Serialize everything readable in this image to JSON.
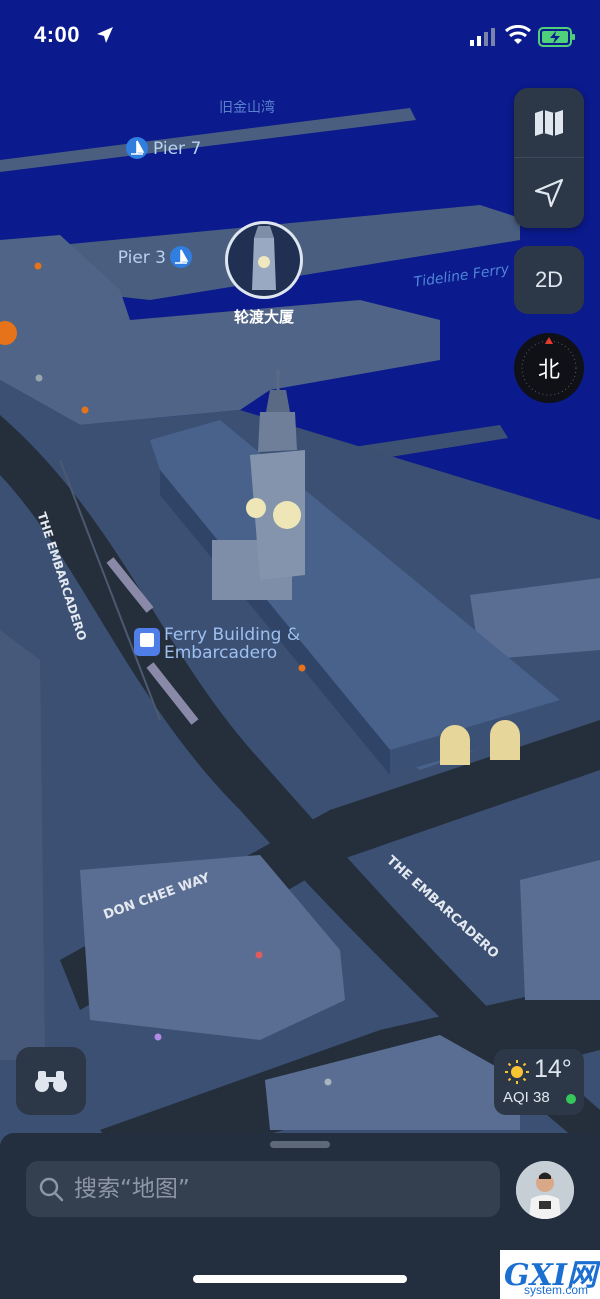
{
  "status_bar": {
    "time": "4:00"
  },
  "map": {
    "water_label": "旧金山湾",
    "poi": [
      {
        "id": "pier7",
        "label": "Pier 7",
        "icon": "sailboat-icon"
      },
      {
        "id": "pier3",
        "label": "Pier 3",
        "icon": "sailboat-icon"
      },
      {
        "id": "ferry_building",
        "label": "轮渡大厦",
        "icon": "clock-tower-icon"
      },
      {
        "id": "transit",
        "label_line1": "Ferry Building &",
        "label_line2": "Embarcadero",
        "icon": "tram-icon"
      }
    ],
    "route_label": "Tideline Ferry",
    "street_labels": [
      "THE EMBARCADERO",
      "THE EMBARCADERO",
      "DON CHEE WAY"
    ]
  },
  "controls": {
    "map_mode_icon": "map-icon",
    "location_icon": "location-arrow-icon",
    "view_toggle": "2D",
    "compass_label": "北",
    "binoculars_icon": "binoculars-icon"
  },
  "weather": {
    "temperature": "14°",
    "aqi": "AQI 38",
    "icon": "sun-icon",
    "aqi_color": "#35c759"
  },
  "bottom_sheet": {
    "search_placeholder": "搜索“地图”"
  },
  "watermark": {
    "main": "GXI网",
    "sub": "system.com"
  },
  "colors": {
    "water": "#0b1a8c",
    "land": "#3f5778",
    "road": "#252e3b",
    "panel": "#2c3848"
  }
}
